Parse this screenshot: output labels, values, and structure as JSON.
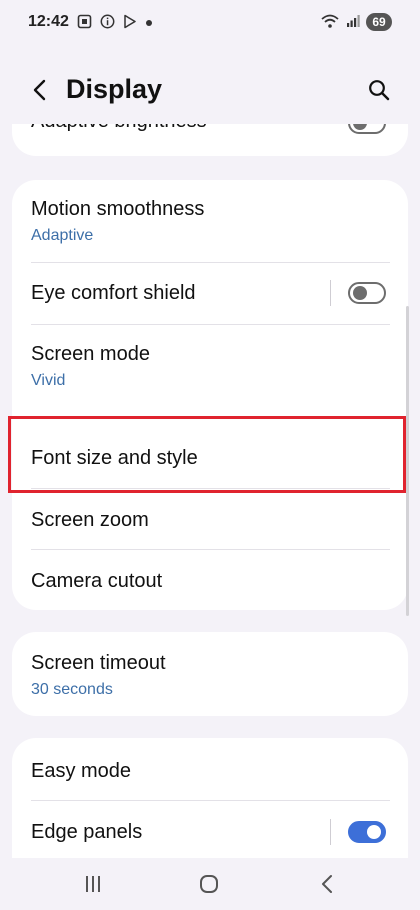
{
  "status_bar": {
    "time": "12:42",
    "icons_left": [
      "screenshot-icon",
      "info-icon",
      "play-store-icon",
      "dot-icon"
    ],
    "icons_right": [
      "wifi-icon",
      "signal-icon"
    ],
    "battery": "69"
  },
  "header": {
    "title": "Display",
    "back_icon": "back-arrow-icon",
    "search_icon": "search-icon"
  },
  "settings": {
    "adaptive_brightness": {
      "title": "Adaptive brightness",
      "toggle_on": false
    },
    "motion_smoothness": {
      "title": "Motion smoothness",
      "value": "Adaptive"
    },
    "eye_comfort_shield": {
      "title": "Eye comfort shield",
      "toggle_on": false
    },
    "screen_mode": {
      "title": "Screen mode",
      "value": "Vivid"
    },
    "font_size_style": {
      "title": "Font size and style"
    },
    "screen_zoom": {
      "title": "Screen zoom"
    },
    "camera_cutout": {
      "title": "Camera cutout"
    },
    "screen_timeout": {
      "title": "Screen timeout",
      "value": "30 seconds"
    },
    "easy_mode": {
      "title": "Easy mode"
    },
    "edge_panels": {
      "title": "Edge panels",
      "toggle_on": true
    }
  },
  "colors": {
    "accent": "#3d6fd8",
    "subtext": "#3d6fa8",
    "highlight": "#e0232e",
    "background": "#f4f2f8"
  },
  "nav_bar": {
    "icons": [
      "recent-apps-icon",
      "home-icon",
      "back-nav-icon"
    ]
  }
}
